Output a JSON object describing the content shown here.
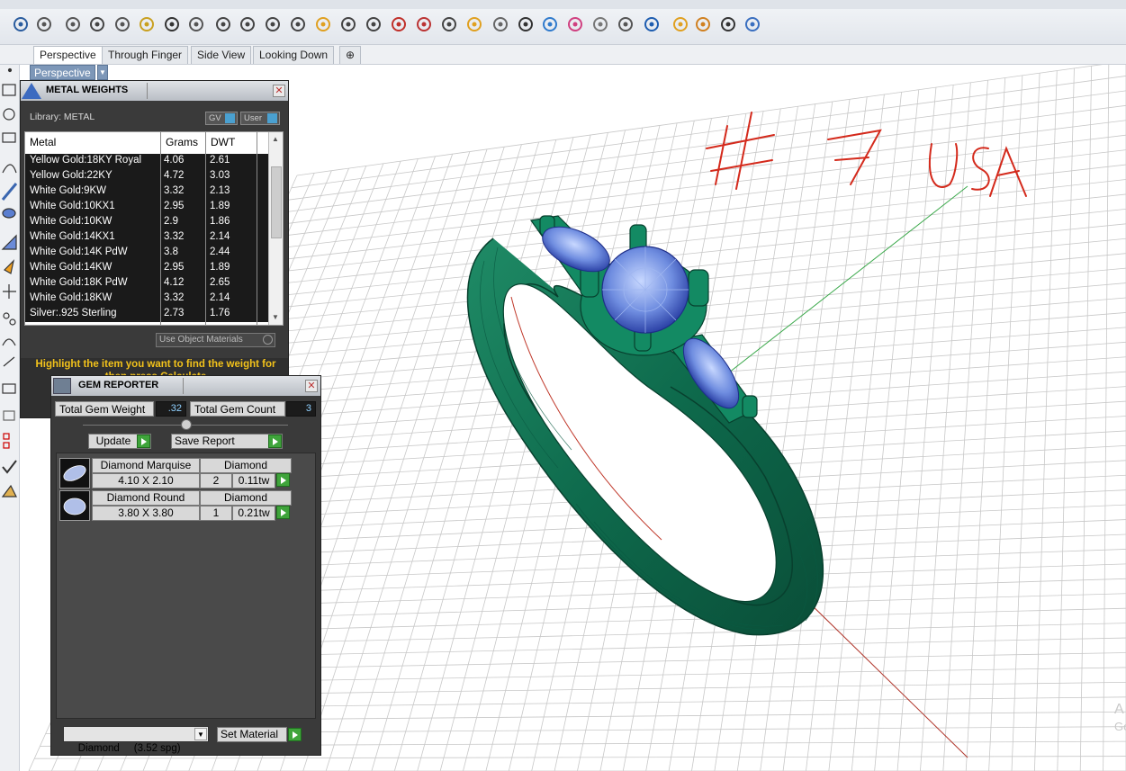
{
  "toolbar": {
    "icons": [
      "save-icon",
      "print-icon",
      "properties-icon",
      "cut-icon",
      "copy-icon",
      "paste-icon",
      "undo-icon",
      "pan-hand-icon",
      "move-view-icon",
      "zoom-icon",
      "zoom-window-icon",
      "zoom-extents-icon",
      "zoom-selected-icon",
      "rotate-view-icon",
      "four-viewports-icon",
      "car-icon",
      "eraser-icon",
      "snap-icon",
      "point-edit-icon",
      "light-bulb-icon",
      "lock-icon",
      "layer-icon",
      "color-wheel-icon",
      "shading-icon",
      "rendered-icon",
      "globe-icon",
      "flag-icon",
      "settings-gear-icon",
      "connector-icon",
      "help-icon"
    ]
  },
  "tabs": [
    "Perspective",
    "Through Finger",
    "Side View",
    "Looking Down"
  ],
  "viewport": {
    "label": "Perspective",
    "annotation": "# 7 USA",
    "watermark": "A\nGo"
  },
  "metal_weights": {
    "title": "METAL WEIGHTS",
    "library_label": "Library: METAL",
    "gv_label": "GV",
    "user_label": "User",
    "columns": [
      "Metal",
      "Grams",
      "DWT"
    ],
    "rows": [
      [
        "Yellow Gold:18KY Royal",
        "4.06",
        "2.61"
      ],
      [
        "Yellow Gold:22KY",
        "4.72",
        "3.03"
      ],
      [
        "White Gold:9KW",
        "3.32",
        "2.13"
      ],
      [
        "White Gold:10KX1",
        "2.95",
        "1.89"
      ],
      [
        "White Gold:10KW",
        "2.9",
        "1.86"
      ],
      [
        "White Gold:14KX1",
        "3.32",
        "2.14"
      ],
      [
        "White Gold:14K PdW",
        "3.8",
        "2.44"
      ],
      [
        "White Gold:14KW",
        "2.95",
        "1.89"
      ],
      [
        "White Gold:18K PdW",
        "4.12",
        "2.65"
      ],
      [
        "White Gold:18KW",
        "3.32",
        "2.14"
      ],
      [
        "Silver:.925 Sterling",
        "2.73",
        "1.76"
      ]
    ],
    "use_object_materials": "Use Object Materials",
    "hint": "Highlight the item you want to find the weight for then press Calculate"
  },
  "gem_reporter": {
    "title": "GEM REPORTER",
    "total_weight_label": "Total Gem Weight",
    "total_weight_value": ".32",
    "total_count_label": "Total Gem Count",
    "total_count_value": "3",
    "update_label": "Update",
    "save_report_label": "Save Report",
    "gems": [
      {
        "name": "Diamond Marquise",
        "material": "Diamond",
        "size": "4.10 X 2.10",
        "count": "2",
        "weight": "0.11tw"
      },
      {
        "name": "Diamond Round",
        "material": "Diamond",
        "size": "3.80 X 3.80",
        "count": "1",
        "weight": "0.21tw"
      }
    ],
    "material_select": "Diamond     (3.52 spg)",
    "set_material_label": "Set Material"
  }
}
